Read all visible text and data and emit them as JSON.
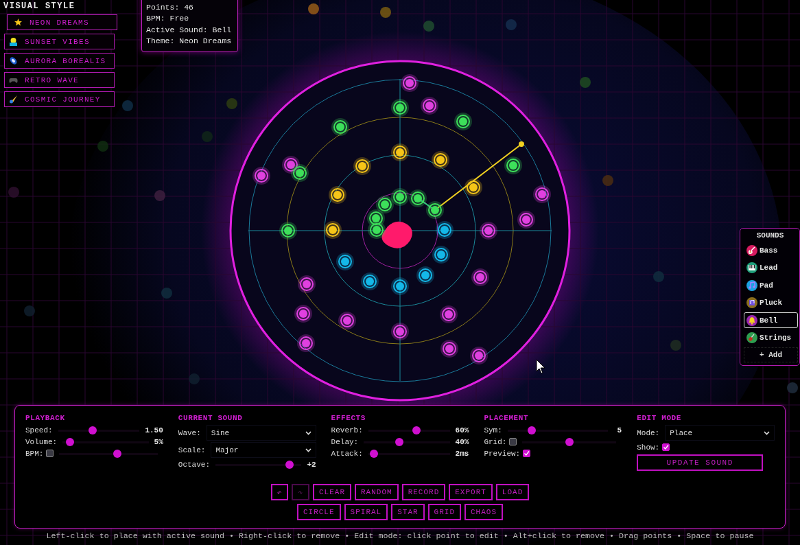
{
  "visual_style": {
    "title": "VISUAL STYLE",
    "themes": [
      {
        "label": "NEON DREAMS",
        "selected": true
      },
      {
        "label": "SUNSET VIBES",
        "selected": false
      },
      {
        "label": "AURORA BOREALIS",
        "selected": false
      },
      {
        "label": "RETRO WAVE",
        "selected": false
      },
      {
        "label": "COSMIC JOURNEY",
        "selected": false
      }
    ]
  },
  "info": {
    "lines": [
      "Points: 46",
      "BPM: Free",
      "Active Sound: Bell",
      "Theme: Neon Dreams"
    ]
  },
  "sounds": {
    "title": "SOUNDS",
    "items": [
      {
        "label": "Bass",
        "color": "#d81b60",
        "selected": false
      },
      {
        "label": "Lead",
        "color": "#1e9e7a",
        "selected": false
      },
      {
        "label": "Pad",
        "color": "#1ba1e2",
        "selected": false
      },
      {
        "label": "Pluck",
        "color": "#8a6d1e",
        "selected": false
      },
      {
        "label": "Bell",
        "color": "#9c27b0",
        "selected": true
      },
      {
        "label": "Strings",
        "color": "#2e9e4f",
        "selected": false
      }
    ],
    "add_button": "+ Add"
  },
  "controls": {
    "sections": [
      {
        "title": "PLAYBACK",
        "rows": [
          {
            "kind": "slider",
            "label": "Speed:",
            "level": 0.42,
            "value": "1.50"
          },
          {
            "kind": "slider",
            "label": "Volume:",
            "level": 0.04,
            "value": "5%"
          },
          {
            "kind": "toggle_slider",
            "label": "BPM:",
            "checked": false,
            "level": 0.6
          }
        ]
      },
      {
        "title": "CURRENT SOUND",
        "rows": [
          {
            "kind": "select",
            "label": "Wave:",
            "value": "Sine"
          },
          {
            "kind": "select",
            "label": "Scale:",
            "value": "Major"
          },
          {
            "kind": "slider",
            "label": "Octave:",
            "level": 0.9,
            "value": "+2"
          }
        ]
      },
      {
        "title": "EFFECTS",
        "rows": [
          {
            "kind": "slider",
            "label": "Reverb:",
            "level": 0.6,
            "value": "60%"
          },
          {
            "kind": "slider",
            "label": "Delay:",
            "level": 0.4,
            "value": "40%"
          },
          {
            "kind": "slider",
            "label": "Attack:",
            "level": 0.02,
            "value": "2ms"
          }
        ]
      },
      {
        "title": "PLACEMENT",
        "rows": [
          {
            "kind": "slider",
            "label": "Sym:",
            "level": 0.22,
            "value": "5"
          },
          {
            "kind": "toggle_slider",
            "label": "Grid:",
            "checked": false,
            "level": 0.5
          },
          {
            "kind": "checkbox",
            "label": "Preview:",
            "checked": true
          }
        ]
      },
      {
        "title": "EDIT MODE",
        "rows": [
          {
            "kind": "select",
            "label": "Mode:",
            "value": "Place"
          },
          {
            "kind": "checkbox",
            "label": "Show:",
            "checked": true
          },
          {
            "kind": "button",
            "label": "UPDATE SOUND"
          }
        ]
      }
    ],
    "button_rows": [
      [
        {
          "label": "↶",
          "disabled": false
        },
        {
          "label": "↷",
          "disabled": true
        },
        {
          "label": "CLEAR",
          "disabled": false
        },
        {
          "label": "RANDOM",
          "disabled": false
        },
        {
          "label": "RECORD",
          "disabled": false
        },
        {
          "label": "EXPORT",
          "disabled": false
        },
        {
          "label": "LOAD",
          "disabled": false
        }
      ],
      [
        {
          "label": "CIRCLE",
          "disabled": false
        },
        {
          "label": "SPIRAL",
          "disabled": false
        },
        {
          "label": "STAR",
          "disabled": false
        },
        {
          "label": "GRID",
          "disabled": false
        },
        {
          "label": "CHAOS",
          "disabled": false
        }
      ]
    ]
  },
  "hint": "Left-click to place with active sound • Right-click to remove • Edit mode: click point to edit • Alt+click to remove • Drag points • Space to pause"
}
